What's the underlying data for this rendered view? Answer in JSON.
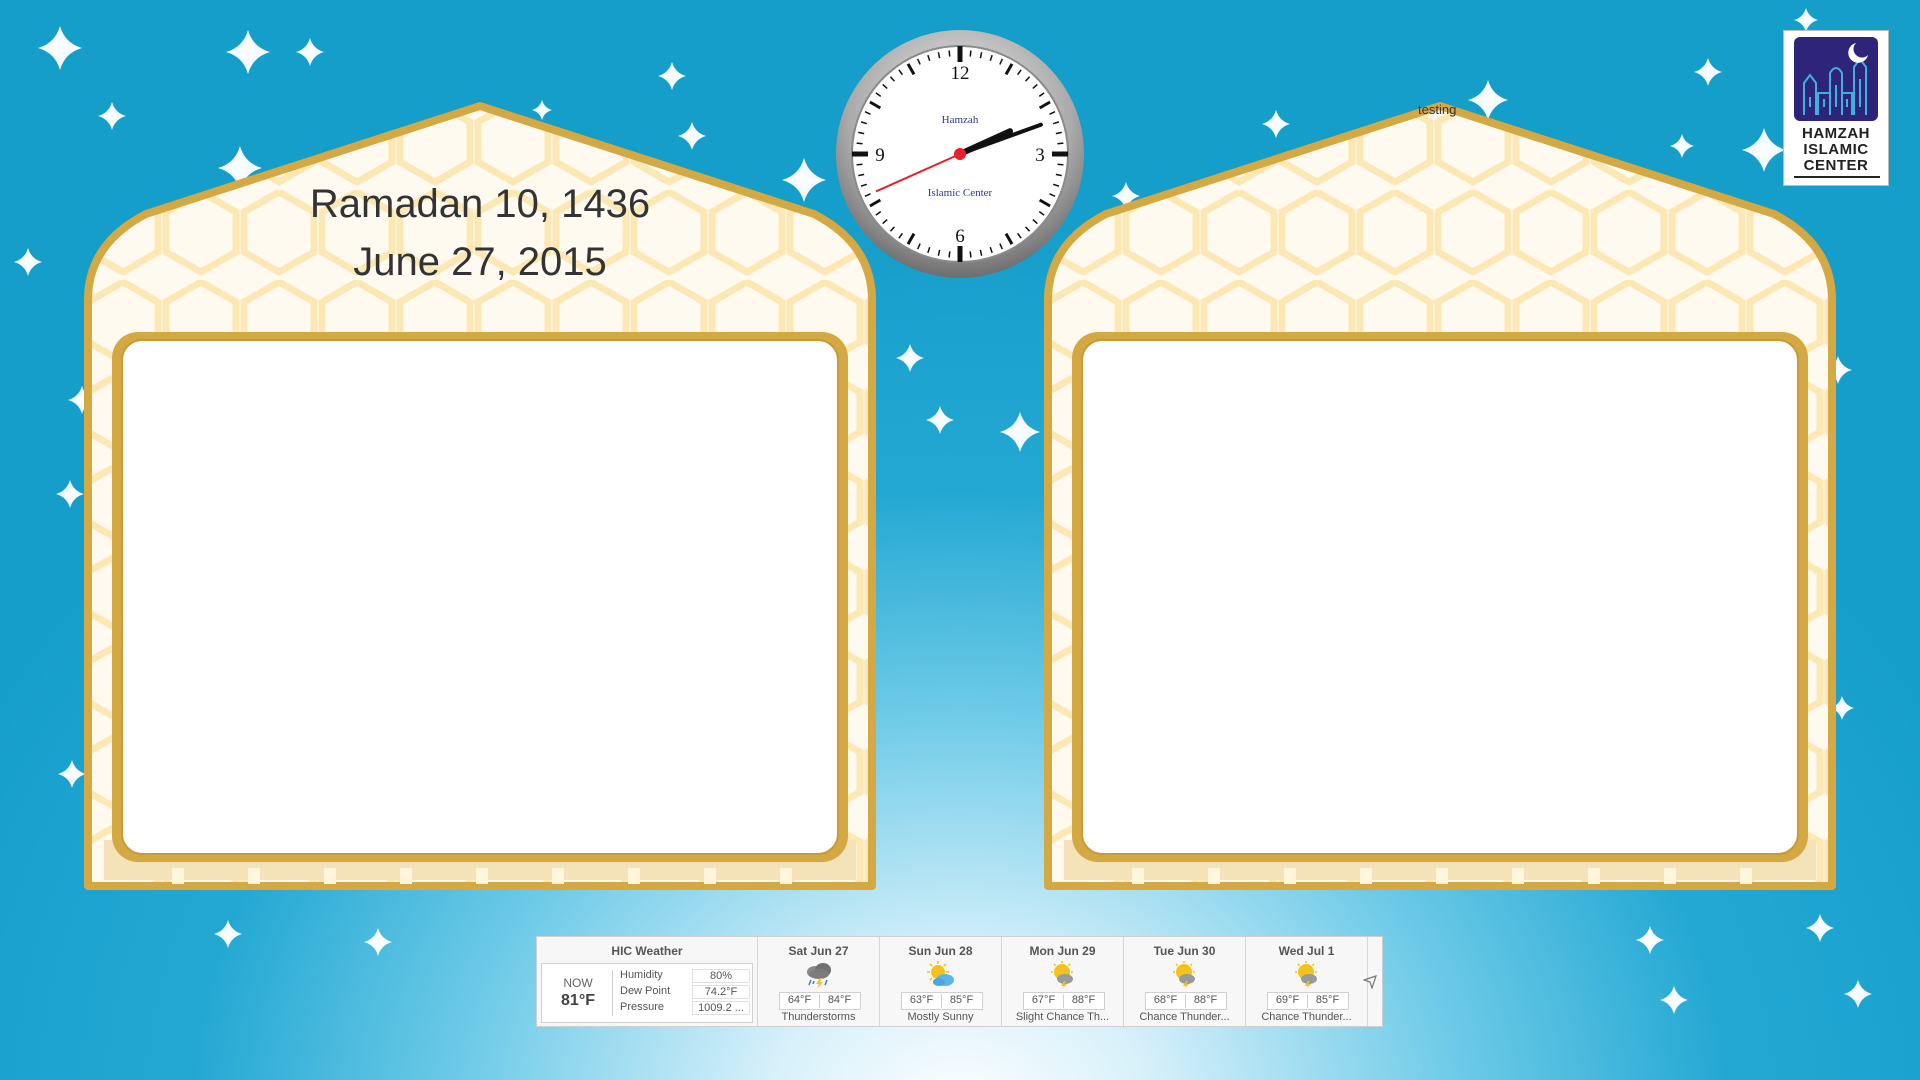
{
  "date": {
    "hijri": "Ramadan 10, 1436",
    "gregorian": "June 27, 2015"
  },
  "clock": {
    "brand_line1": "Hamzah",
    "brand_line2": "Islamic Center",
    "numerals": [
      "12",
      "3",
      "6",
      "9"
    ],
    "time": {
      "hour": 2,
      "minute": 11,
      "second": 41
    },
    "second_hand_color": "#e8202a"
  },
  "right_panel": {
    "label": "testing"
  },
  "logo": {
    "lines": [
      "HAMZAH",
      "ISLAMIC",
      "CENTER"
    ],
    "icon": "mosque-icon",
    "color": "#2e2479"
  },
  "weather": {
    "title": "HIC Weather",
    "now": {
      "label": "NOW",
      "temp": "81°F",
      "details": [
        {
          "key": "Humidity",
          "value": "80%"
        },
        {
          "key": "Dew Point",
          "value": "74.2°F"
        },
        {
          "key": "Pressure",
          "value": "1009.2 ..."
        }
      ]
    },
    "days": [
      {
        "name": "Sat Jun 27",
        "low": "64°F",
        "high": "84°F",
        "condition": "Thunderstorms",
        "icon": "thunderstorm-icon"
      },
      {
        "name": "Sun Jun 28",
        "low": "63°F",
        "high": "85°F",
        "condition": "Mostly Sunny",
        "icon": "mostly-sunny-icon"
      },
      {
        "name": "Mon Jun 29",
        "low": "67°F",
        "high": "88°F",
        "condition": "Slight Chance Th...",
        "icon": "sun-storm-icon"
      },
      {
        "name": "Tue Jun 30",
        "low": "68°F",
        "high": "88°F",
        "condition": "Chance Thunder...",
        "icon": "sun-storm-icon"
      },
      {
        "name": "Wed Jul 1",
        "low": "69°F",
        "high": "85°F",
        "condition": "Chance Thunder...",
        "icon": "sun-storm-icon"
      }
    ]
  },
  "colors": {
    "frame_gold": "#d4a843",
    "hex_pattern": "#fbe8b4",
    "background": "#169ecb"
  }
}
